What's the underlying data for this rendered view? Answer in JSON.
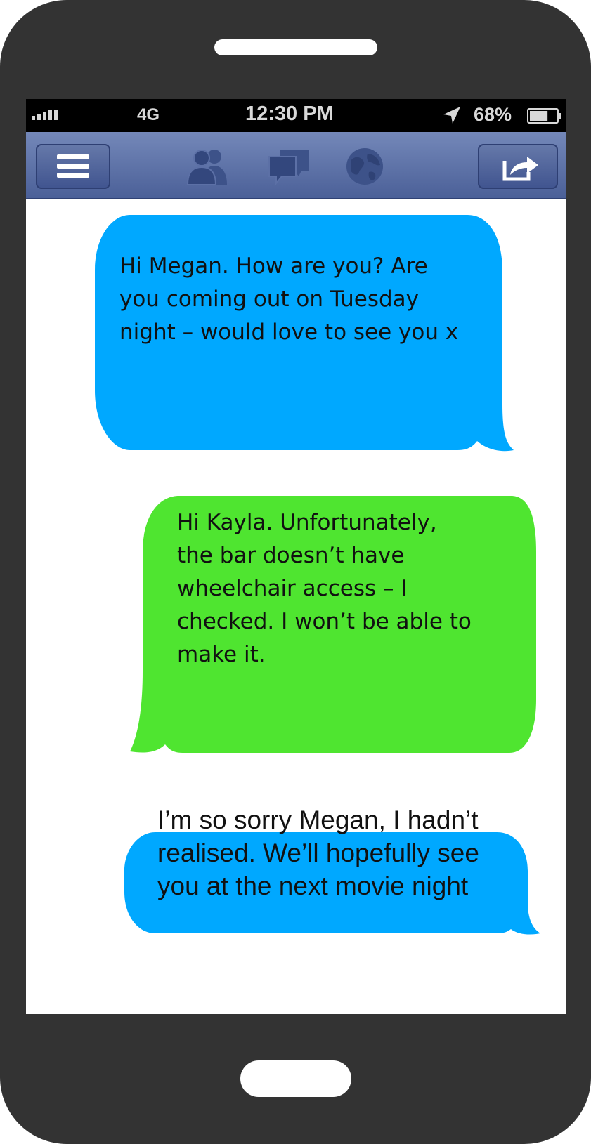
{
  "status_bar": {
    "network": "4G",
    "time": "12:30 PM",
    "battery_percent": "68%",
    "battery_level": 0.68,
    "signal_bars": 4
  },
  "nav_bar": {
    "icons": [
      "menu-icon",
      "friends-icon",
      "messages-icon",
      "globe-icon",
      "share-icon"
    ],
    "accent": "#5a6ea5"
  },
  "messages": [
    {
      "text": "Hi Megan. How are you? Are you coming out on Tuesday night – would love to see you x",
      "color": "#00a8ff",
      "tail": "right"
    },
    {
      "text": "Hi Kayla. Unfortunately, the bar doesn’t have wheelchair access – I checked. I won’t be able to make it.",
      "color": "#4fe530",
      "tail": "left"
    },
    {
      "text": "I’m so sorry Megan, I hadn’t realised. We’ll hopefully see you at the next movie night",
      "color": "#00a8ff",
      "tail": "right"
    }
  ]
}
